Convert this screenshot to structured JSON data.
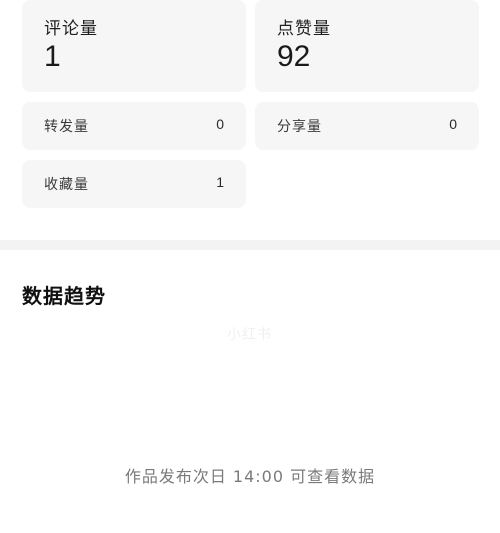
{
  "stats": {
    "comments": {
      "label": "评论量",
      "value": "1"
    },
    "likes": {
      "label": "点赞量",
      "value": "92"
    },
    "reposts": {
      "label": "转发量",
      "value": "0"
    },
    "shares": {
      "label": "分享量",
      "value": "0"
    },
    "favorites": {
      "label": "收藏量",
      "value": "1"
    }
  },
  "trend": {
    "title": "数据趋势",
    "watermark": "小红书",
    "notice": "作品发布次日 14:00 可查看数据"
  }
}
